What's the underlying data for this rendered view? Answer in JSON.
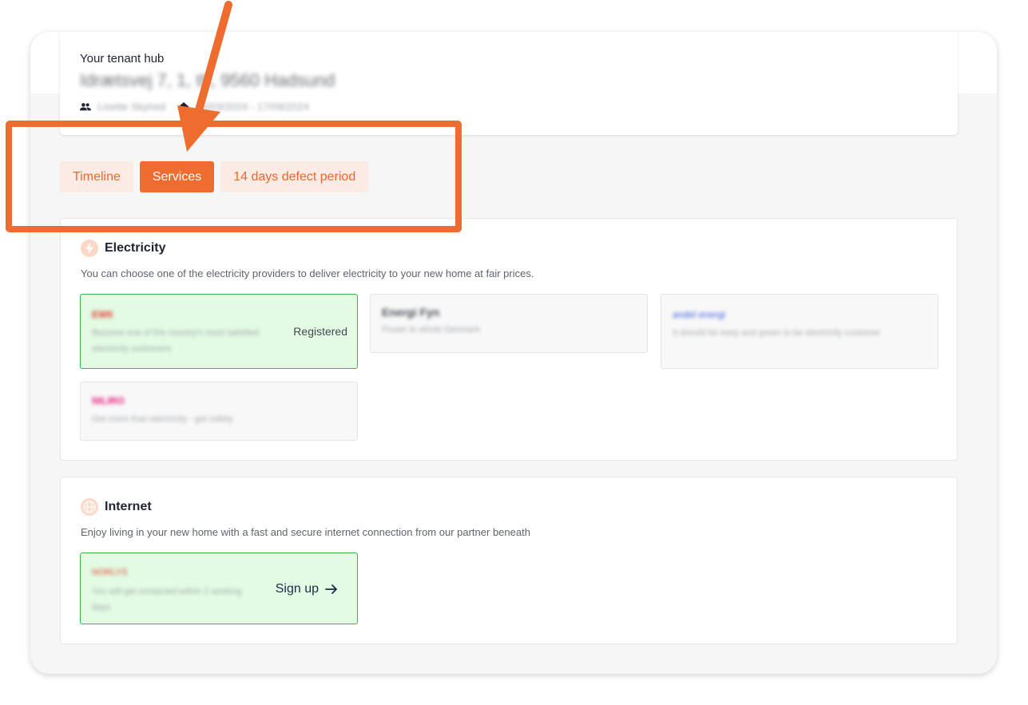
{
  "hub": {
    "label": "Your tenant hub",
    "address": "Idrætsvej 7, 1, th, 9560 Hadsund",
    "tenant_name": "Lisette Skyhed",
    "period": "15/03/2024 - 17/09/2024",
    "people_icon": "people-icon",
    "home_icon": "home-icon"
  },
  "tabs": [
    {
      "label": "Timeline",
      "active": false
    },
    {
      "label": "Services",
      "active": true
    },
    {
      "label": "14 days defect period",
      "active": false
    }
  ],
  "electricity": {
    "title": "Electricity",
    "icon": "lightning-icon",
    "description": "You can choose one of the electricity providers to deliver electricity to your new home at fair prices.",
    "providers": [
      {
        "name": "EWII",
        "description": "Become one of the country's most satisfied electricity customers",
        "status": "Registered",
        "color": "#e63b2e",
        "selected": true
      },
      {
        "name": "Energi Fyn",
        "description": "Power to whole Denmark",
        "status": "",
        "color": "#4a4f57",
        "selected": false
      },
      {
        "name": "andel energi",
        "description": "It should be easy and green to be electricity customer",
        "status": "",
        "color": "#3b5bdb",
        "selected": false
      },
      {
        "name": "NILIRO",
        "description": "Get more than electricity - get safety",
        "status": "",
        "color": "#e6197d",
        "selected": false
      }
    ]
  },
  "internet": {
    "title": "Internet",
    "icon": "globe-icon",
    "description": "Enjoy living in your new home with a fast and secure internet connection from our partner beneath",
    "providers": [
      {
        "name": "NORLYS",
        "description": "You will get contacted within 2 working days",
        "action": "Sign up",
        "action_icon": "arrow-right-icon",
        "color": "#e63b2e",
        "selected": true
      }
    ]
  },
  "colors": {
    "accent": "#ee6c2d",
    "tab_inactive_bg": "#fbebe4",
    "selected_bg": "#e3fbe3",
    "selected_border": "#39b54a"
  }
}
